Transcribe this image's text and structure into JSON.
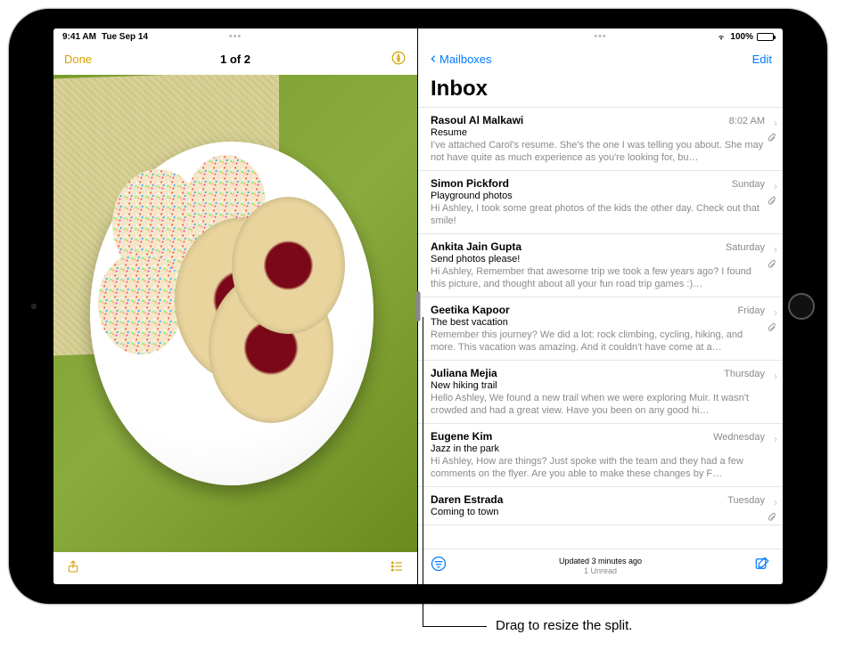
{
  "statusbar": {
    "time": "9:41 AM",
    "date": "Tue Sep 14",
    "battery_pct": "100%"
  },
  "photo_viewer": {
    "done_label": "Done",
    "counter": "1 of 2",
    "multitask_dots": "•••"
  },
  "mail": {
    "back_label": "Mailboxes",
    "edit_label": "Edit",
    "title": "Inbox",
    "multitask_dots": "•••",
    "status_line1": "Updated 3 minutes ago",
    "status_line2": "1 Unread",
    "items": [
      {
        "sender": "Rasoul Al Malkawi",
        "time": "8:02 AM",
        "subject": "Resume",
        "preview": "I've attached Carol's resume. She's the one I was telling you about. She may not have quite as much experience as you're looking for, bu…",
        "has_attachment": true
      },
      {
        "sender": "Simon Pickford",
        "time": "Sunday",
        "subject": "Playground photos",
        "preview": "Hi Ashley, I took some great photos of the kids the other day. Check out that smile!",
        "has_attachment": true
      },
      {
        "sender": "Ankita Jain Gupta",
        "time": "Saturday",
        "subject": "Send photos please!",
        "preview": "Hi Ashley, Remember that awesome trip we took a few years ago? I found this picture, and thought about all your fun road trip games :)…",
        "has_attachment": true
      },
      {
        "sender": "Geetika Kapoor",
        "time": "Friday",
        "subject": "The best vacation",
        "preview": "Remember this journey? We did a lot: rock climbing, cycling, hiking, and more. This vacation was amazing. And it couldn't have come at a…",
        "has_attachment": true
      },
      {
        "sender": "Juliana Mejia",
        "time": "Thursday",
        "subject": "New hiking trail",
        "preview": "Hello Ashley, We found a new trail when we were exploring Muir. It wasn't crowded and had a great view. Have you been on any good hi…",
        "has_attachment": false
      },
      {
        "sender": "Eugene Kim",
        "time": "Wednesday",
        "subject": "Jazz in the park",
        "preview": "Hi Ashley, How are things? Just spoke with the team and they had a few comments on the flyer. Are you able to make these changes by F…",
        "has_attachment": false
      },
      {
        "sender": "Daren Estrada",
        "time": "Tuesday",
        "subject": "Coming to town",
        "preview": "",
        "has_attachment": true
      }
    ]
  },
  "caption": "Drag to resize the split."
}
